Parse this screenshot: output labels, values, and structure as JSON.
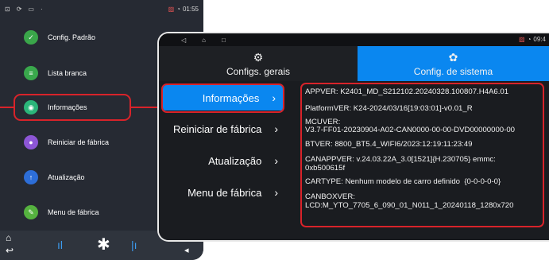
{
  "back_phone": {
    "status_time": "01:55",
    "menu_items": [
      {
        "label": "Config. Padrão",
        "color": "#3aa64a",
        "icon": "check-icon"
      },
      {
        "label": "Lista branca",
        "color": "#39a84c",
        "icon": "list-icon"
      },
      {
        "label": "Informações",
        "color": "#2bb57a",
        "icon": "info-icon"
      },
      {
        "label": "Reiniciar de fábrica",
        "color": "#8d56d6",
        "icon": "reset-icon"
      },
      {
        "label": "Atualização",
        "color": "#2d6ed8",
        "icon": "update-icon"
      },
      {
        "label": "Menu de fábrica",
        "color": "#55b23f",
        "icon": "factory-icon"
      }
    ]
  },
  "tablet": {
    "status_time": "09:4",
    "tabs": {
      "geral": "Configs. gerais",
      "sistema": "Config. de sistema"
    },
    "menu": {
      "info": "Informações",
      "reset": "Reiniciar de fábrica",
      "update": "Atualização",
      "factory": "Menu de fábrica"
    },
    "info_lines": [
      "APPVER: K2401_MD_S212102.20240328.100807.H4A6.01",
      "PlatformVER: K24-2024/03/16[19:03:01]-v0.01_R",
      "MCUVER:",
      "V3.7-FF01-20230904-A02-CAN0000-00-00-DVD00000000-00",
      "BTVER: 8800_BT5.4_WIFI6/2023:12:19:11:23:49",
      "CANAPPVER: v.24.03.22A_3.0[1521]{H.230705} emmc:",
      "0xb500615f",
      "CARTYPE: Nenhum modelo de carro definido  {0-0-0-0-0}",
      "CANBOXVER:",
      "LCD:M_YTO_7705_6_090_01_N011_1_20240118_1280x720"
    ]
  },
  "colors": {
    "accent": "#0a87f0",
    "highlight": "#d8232a"
  }
}
